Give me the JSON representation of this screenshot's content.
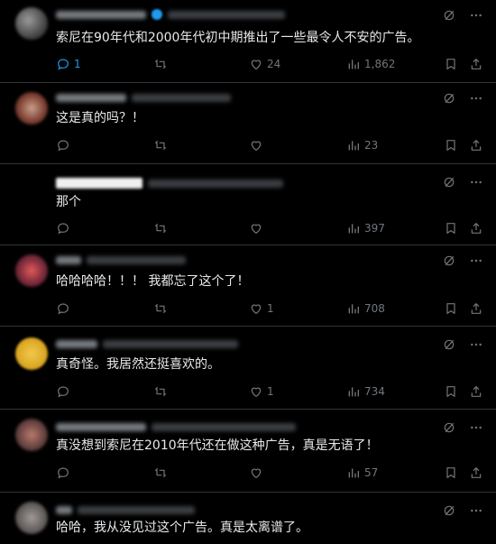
{
  "posts": [
    {
      "text": "索尼在90年代和2000年代初中期推出了一些最令人不安的广告。",
      "replies": "1",
      "likes": "24",
      "views": "1,862"
    },
    {
      "text": "这是真的吗？！",
      "replies": "",
      "likes": "",
      "views": "23"
    },
    {
      "text": "那个",
      "replies": "",
      "likes": "",
      "views": "397"
    },
    {
      "text": "哈哈哈哈！！！ 我都忘了这个了！",
      "replies": "",
      "likes": "1",
      "views": "708"
    },
    {
      "text": "真奇怪。我居然还挺喜欢的。",
      "replies": "",
      "likes": "1",
      "views": "734"
    },
    {
      "text": "真没想到索尼在2010年代还在做这种广告，真是无语了！",
      "replies": "",
      "likes": "",
      "views": "57"
    },
    {
      "text": "哈哈，我从没见过这个广告。真是太离谱了。",
      "replies": "",
      "likes": "",
      "views": ""
    }
  ],
  "colors": {
    "accent": "#1d9bf0",
    "muted": "#71767b",
    "text": "#e7e9ea",
    "border": "#2f3336"
  },
  "icons": [
    "reply-icon",
    "retweet-icon",
    "like-icon",
    "views-icon",
    "bookmark-icon",
    "share-icon",
    "grok-icon",
    "more-icon"
  ]
}
